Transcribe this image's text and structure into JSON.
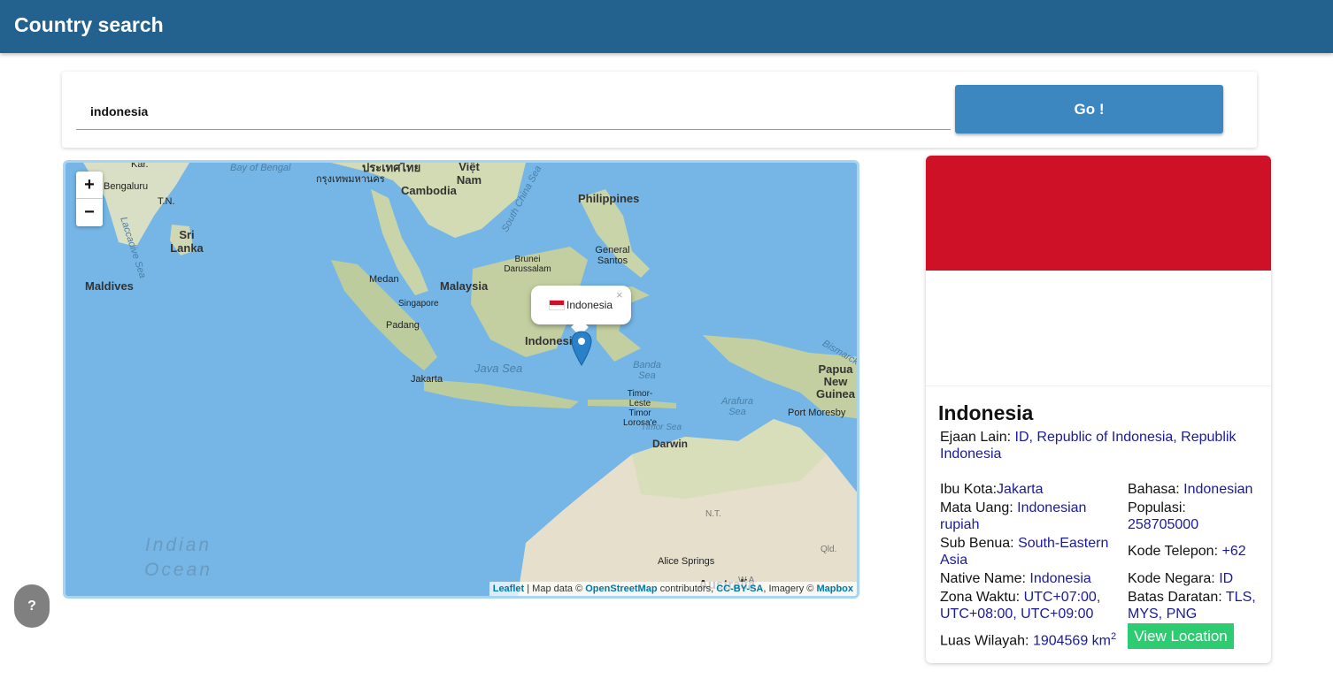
{
  "app": {
    "title": "Country search"
  },
  "search": {
    "value": "indonesia",
    "button_label": "Go !"
  },
  "map": {
    "zoom_in": "+",
    "zoom_out": "−",
    "labels": {
      "bay_of_bengal": "Bay of Bengal",
      "bengaluru": "Bengaluru",
      "tn": "T.N.",
      "kar": "Kar.",
      "sri_lanka": "Sri Lanka",
      "laccadive_sea": "Laccadive Sea",
      "maldives": "Maldives",
      "bangkok": "กรุงเทพมหานคร",
      "thailand": "ประเทศไทย",
      "viet_nam": "Việt Nam",
      "cambodia": "Cambodia",
      "south_china_sea": "South China Sea",
      "philippines": "Philippines",
      "general_santos": "General Santos",
      "brunei": "Brunei Darussalam",
      "medan": "Medan",
      "malaysia": "Malaysia",
      "singapore": "Singapore",
      "padang": "Padang",
      "indonesia": "Indonesia",
      "java_sea": "Java Sea",
      "jakarta": "Jakarta",
      "banda_sea": "Banda Sea",
      "arafura_sea": "Arafura Sea",
      "timor_leste": "Timor-Leste Timor Lorosa'e",
      "timor_sea": "Timor Sea",
      "darwin": "Darwin",
      "papua_new_guinea": "Papua New Guinea",
      "port_moresby": "Port Moresby",
      "bismarck": "Bismarck",
      "nt": "N.T.",
      "qld": "Qld.",
      "wa": "W.A.",
      "australia": "Australia",
      "alice_springs": "Alice Springs",
      "indian_ocean": "Indian Ocean"
    },
    "popup": {
      "label": "Indonesia",
      "close": "×"
    },
    "attribution": {
      "leaflet": "Leaflet",
      "text1": " | Map data © ",
      "osm": "OpenStreetMap",
      "text2": " contributors, ",
      "ccbysa": "CC-BY-SA",
      "text3": ", Imagery © ",
      "mapbox": "Mapbox"
    }
  },
  "country": {
    "name": "Indonesia",
    "flag_colors": {
      "top": "#ce1126",
      "bottom": "#ffffff"
    },
    "ejaan_lain": {
      "label": "Ejaan Lain: ",
      "value": "ID, Republic of Indonesia, Republik Indonesia"
    },
    "ibu_kota": {
      "label": "Ibu Kota:",
      "value": "Jakarta"
    },
    "mata_uang": {
      "label": "Mata Uang: ",
      "value": "Indonesian rupiah"
    },
    "sub_benua": {
      "label": "Sub Benua: ",
      "value": "South-Eastern Asia"
    },
    "native_name": {
      "label": "Native Name: ",
      "value": "Indonesia"
    },
    "zona_waktu": {
      "label": "Zona Waktu: ",
      "value": "UTC+07:00, UTC+08:00, UTC+09:00"
    },
    "luas_wilayah": {
      "label": "Luas Wilayah: ",
      "value": "1904569 km",
      "unit_sup": "2"
    },
    "bahasa": {
      "label": "Bahasa: ",
      "value": "Indonesian"
    },
    "populasi": {
      "label": "Populasi: ",
      "value": "258705000"
    },
    "kode_telepon": {
      "label": "Kode Telepon: ",
      "value": "+62"
    },
    "kode_negara": {
      "label": "Kode Negara: ",
      "value": "ID"
    },
    "batas_daratan": {
      "label": "Batas Daratan: ",
      "value": "TLS, MYS, PNG"
    },
    "view_location": "View Location"
  },
  "help": {
    "label": "?"
  }
}
